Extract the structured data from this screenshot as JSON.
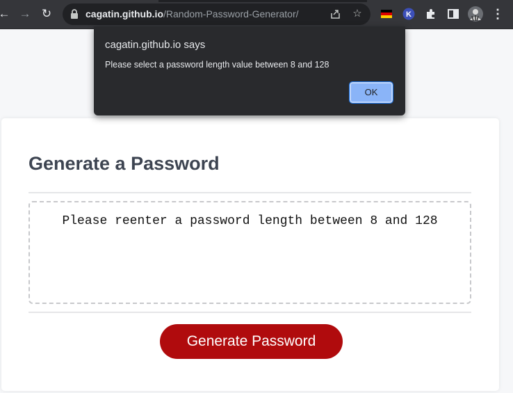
{
  "browser": {
    "url_host": "cagatin.github.io",
    "url_path": "/Random-Password-Generator/"
  },
  "page": {
    "title": "Generate a Password",
    "password_output": "Please reenter a password length between 8 and 128",
    "generate_button": "Generate Password"
  },
  "dialog": {
    "title": "cagatin.github.io says",
    "message": "Please select a password length value between 8 and 128",
    "ok_label": "OK"
  },
  "colors": {
    "button": "#b00b0d",
    "ok_button": "#8ab4f8",
    "heading": "#3d4451"
  },
  "icons": [
    "back-icon",
    "forward-icon",
    "reload-icon",
    "lock-icon",
    "share-icon",
    "star-icon",
    "flag-extension-icon",
    "k-extension-icon",
    "puzzle-icon",
    "side-panel-icon",
    "profile-avatar",
    "menu-icon"
  ]
}
